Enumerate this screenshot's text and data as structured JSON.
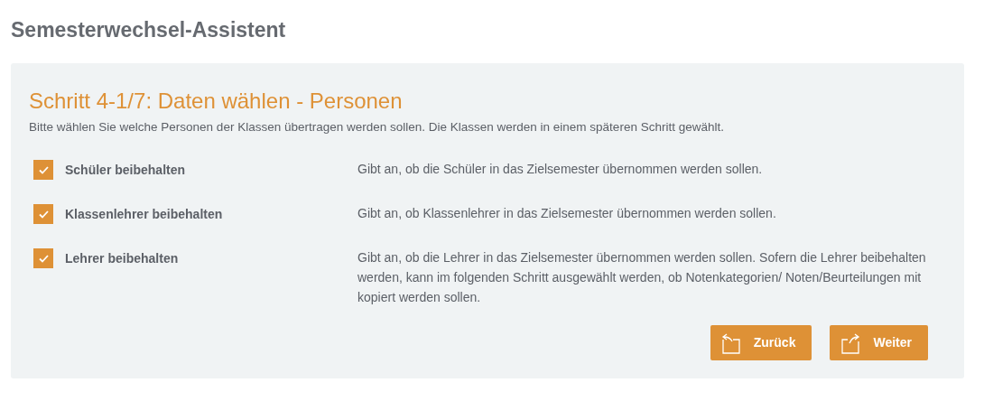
{
  "page_title": "Semesterwechsel-Assistent",
  "step": {
    "title": "Schritt 4-1/7: Daten wählen - Personen",
    "description": "Bitte wählen Sie welche Personen der Klassen übertragen werden sollen. Die Klassen werden in einem späteren Schritt gewählt."
  },
  "options": [
    {
      "label": "Schüler beibehalten",
      "checked": true,
      "description": "Gibt an, ob die Schüler in das Zielsemester übernommen werden sollen."
    },
    {
      "label": "Klassenlehrer beibehalten",
      "checked": true,
      "description": "Gibt an, ob Klassenlehrer in das Zielsemester übernommen werden sollen."
    },
    {
      "label": "Lehrer beibehalten",
      "checked": true,
      "description": "Gibt an, ob die Lehrer in das Zielsemester übernommen werden sollen. Sofern die Lehrer beibehalten werden, kann im folgenden Schritt ausgewählt werden, ob Notenkategorien/ Noten/Beurteilungen mit kopiert werden sollen."
    }
  ],
  "buttons": [
    {
      "label": "Zurück",
      "kind": "back"
    },
    {
      "label": "Weiter",
      "kind": "next"
    }
  ]
}
